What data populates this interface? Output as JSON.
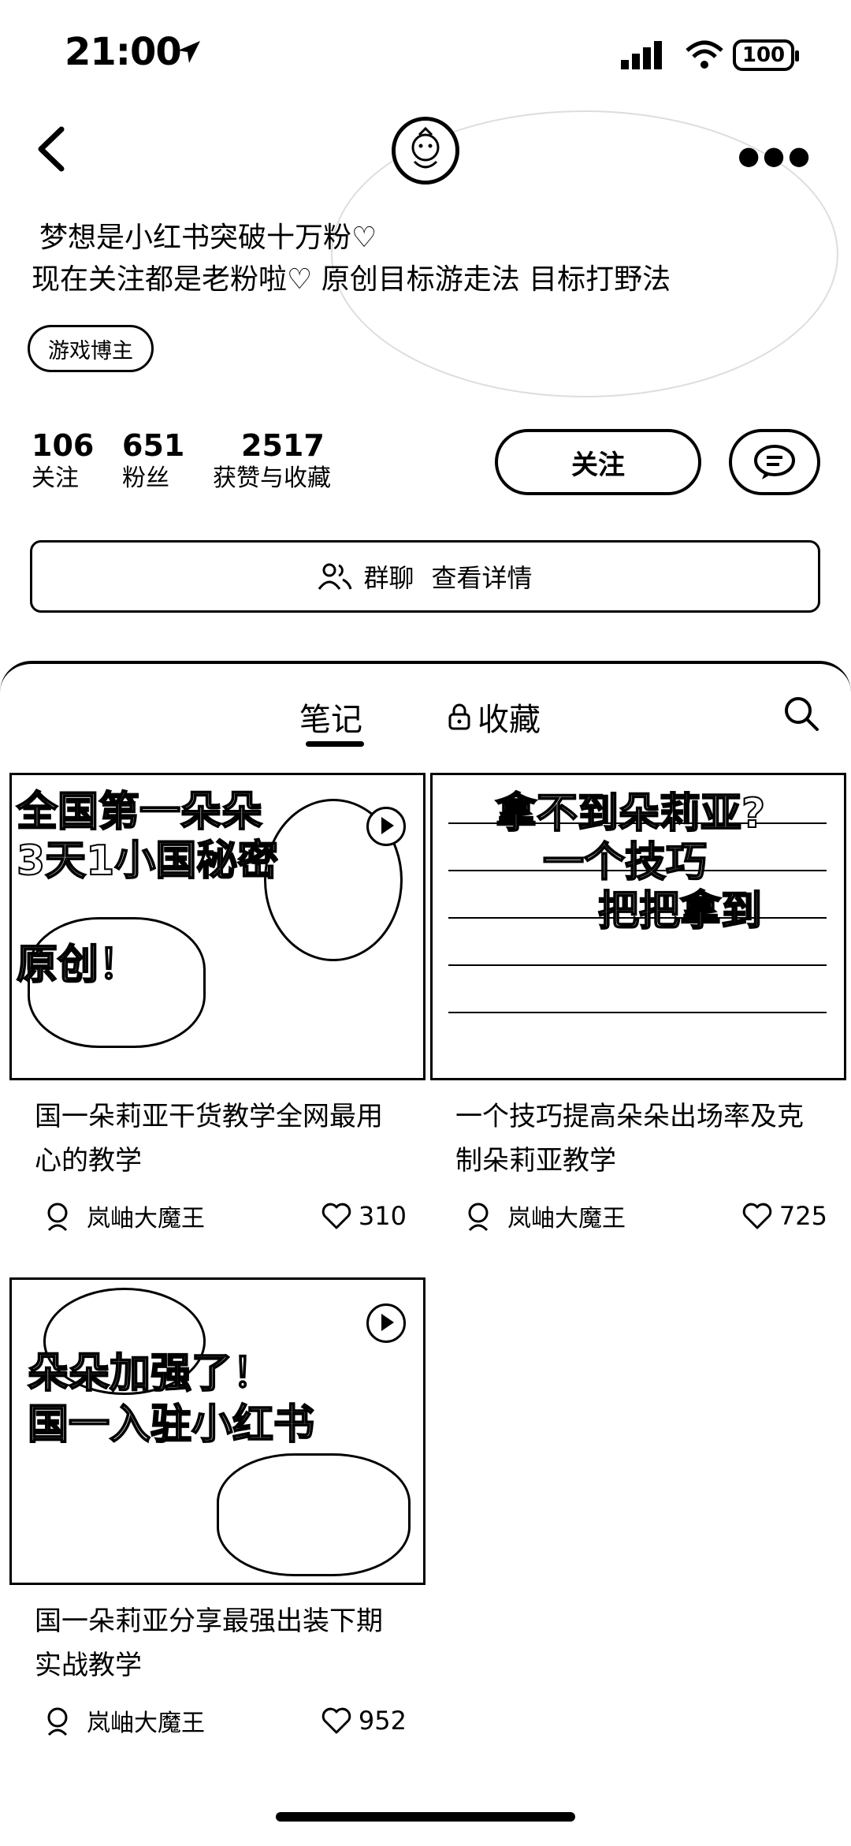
{
  "status_bar": {
    "time": "21:00",
    "battery": "100"
  },
  "profile": {
    "bio_line1": "梦想是小红书突破十万粉♡",
    "bio_line2": "现在关注都是老粉啦♡  原创目标游走法 目标打野法",
    "tag": "游戏博主",
    "stats": [
      {
        "value": "106",
        "label": "关注"
      },
      {
        "value": "651",
        "label": "粉丝"
      },
      {
        "value": "2517",
        "label": "获赞与收藏"
      }
    ],
    "follow_label": "关注",
    "group_label": "群聊",
    "group_detail": "查看详情"
  },
  "tabs": {
    "notes": "笔记",
    "favorites": "收藏"
  },
  "cards": [
    {
      "overlay": [
        "全国第一朵朵",
        "3天1小国秘密",
        "原创！"
      ],
      "title": "国一朵莉亚干货教学全网最用心的教学",
      "author": "岚岫大魔王",
      "likes": "310"
    },
    {
      "overlay": [
        "拿不到朵莉亚?",
        "一个技巧",
        "把把拿到"
      ],
      "title": "一个技巧提高朵朵出场率及克制朵莉亚教学",
      "author": "岚岫大魔王",
      "likes": "725"
    },
    {
      "overlay": [
        "朵朵加强了！",
        "国一入驻小红书"
      ],
      "title": "国一朵莉亚分享最强出装下期实战教学",
      "author": "岚岫大魔王",
      "likes": "952"
    }
  ]
}
